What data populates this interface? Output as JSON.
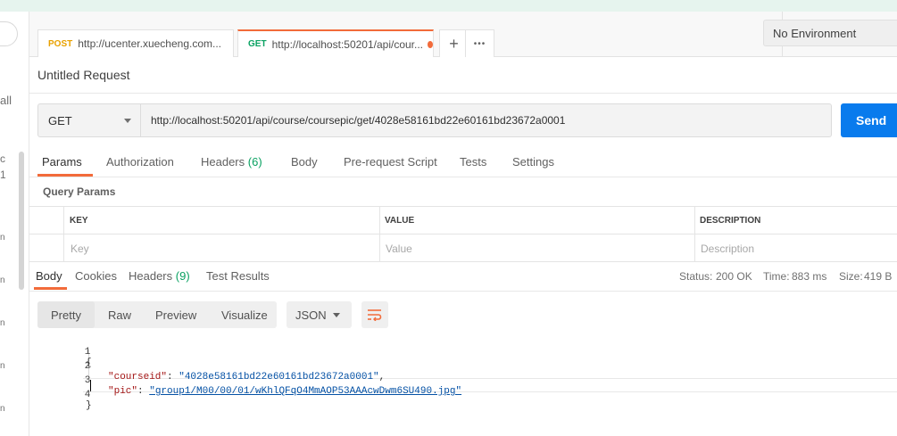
{
  "sidebar": {
    "fragments": [
      "all",
      "c",
      "1",
      "n",
      "n",
      "n",
      "n",
      "n"
    ]
  },
  "tabs": [
    {
      "method": "POST",
      "url": "http://ucenter.xuecheng.com..."
    },
    {
      "method": "GET",
      "url": "http://localhost:50201/api/cour..."
    }
  ],
  "tab_actions": {
    "add": "+",
    "more": "•••"
  },
  "environment": "No Environment",
  "request": {
    "title": "Untitled Request",
    "method": "GET",
    "url": "http://localhost:50201/api/course/coursepic/get/4028e58161bd22e60161bd23672a0001",
    "send_label": "Send"
  },
  "request_tabs": {
    "params": "Params",
    "authorization": "Authorization",
    "headers": "Headers",
    "headers_count": "(6)",
    "body": "Body",
    "prerequest": "Pre-request Script",
    "tests": "Tests",
    "settings": "Settings"
  },
  "query_params": {
    "label": "Query Params",
    "columns": [
      "KEY",
      "VALUE",
      "DESCRIPTION"
    ],
    "placeholders": [
      "Key",
      "Value",
      "Description"
    ]
  },
  "response_tabs": {
    "body": "Body",
    "cookies": "Cookies",
    "headers": "Headers",
    "headers_count": "(9)",
    "test_results": "Test Results"
  },
  "status": {
    "status_label": "Status:",
    "status_value": "200 OK",
    "time_label": "Time:",
    "time_value": "883 ms",
    "size_label": "Size:",
    "size_value": "419 B"
  },
  "formats": [
    "Pretty",
    "Raw",
    "Preview",
    "Visualize"
  ],
  "format_type": "JSON",
  "code": {
    "line_numbers": [
      "1",
      "2",
      "3",
      "4"
    ],
    "open_brace": "{",
    "close_brace": "}",
    "key1": "\"courseid\"",
    "val1": "\"4028e58161bd22e60161bd23672a0001\"",
    "key2": "\"pic\"",
    "val2": "\"group1/M00/00/01/wKhlQFqO4MmAOP53AAAcwDwm6SU490.jpg\""
  },
  "colors": {
    "accent": "#f26b3a",
    "send": "#097bed",
    "success": "#0aa262",
    "post": "#e8a100"
  }
}
